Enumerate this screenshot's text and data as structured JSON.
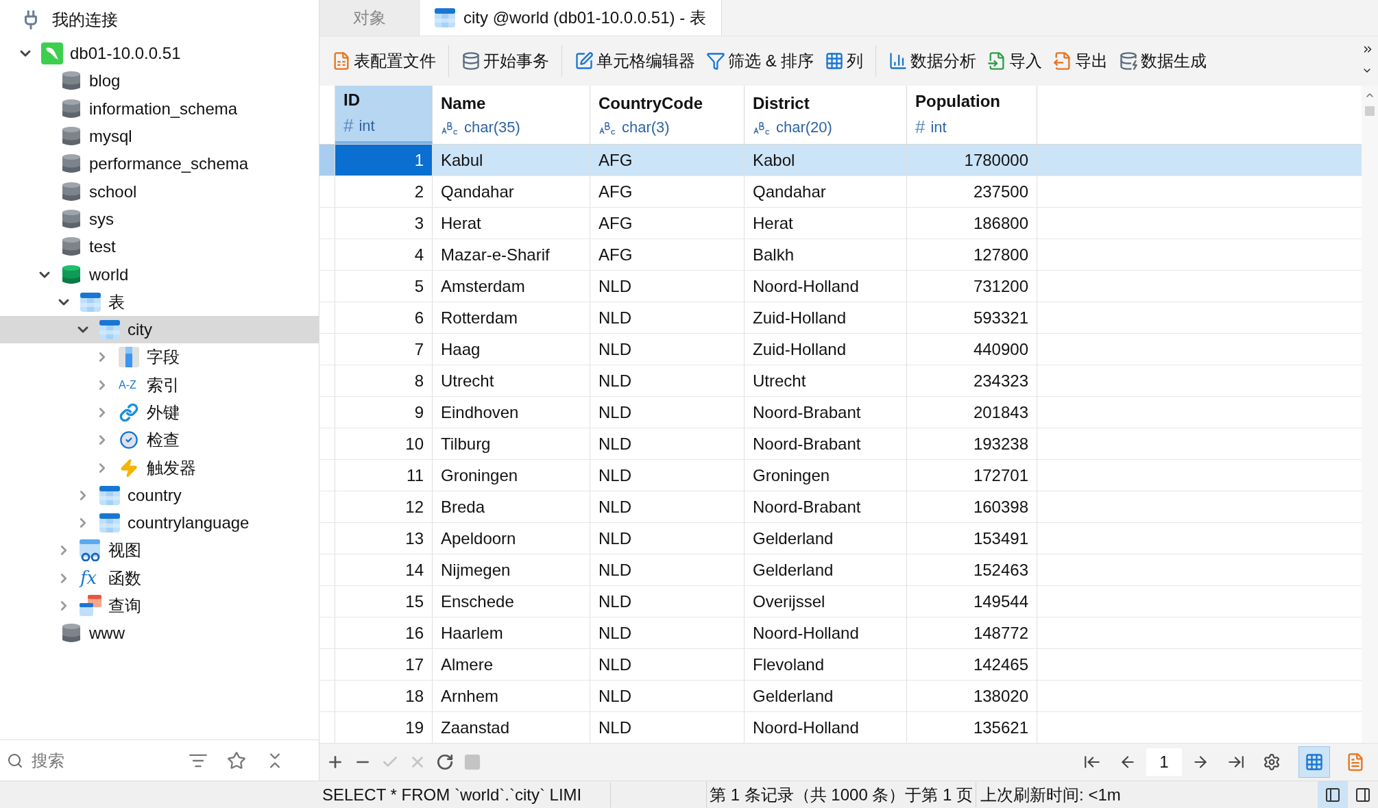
{
  "sidebar": {
    "title": "我的连接",
    "tree": [
      {
        "label": "db01-10.0.0.51",
        "kind": "connection",
        "expanded": true,
        "selected": false,
        "children": [
          {
            "label": "blog",
            "kind": "database",
            "open": false,
            "selected": false
          },
          {
            "label": "information_schema",
            "kind": "database",
            "open": false,
            "selected": false
          },
          {
            "label": "mysql",
            "kind": "database",
            "open": false,
            "selected": false
          },
          {
            "label": "performance_schema",
            "kind": "database",
            "open": false,
            "selected": false
          },
          {
            "label": "school",
            "kind": "database",
            "open": false,
            "selected": false
          },
          {
            "label": "sys",
            "kind": "database",
            "open": false,
            "selected": false
          },
          {
            "label": "test",
            "kind": "database",
            "open": false,
            "selected": false
          },
          {
            "label": "world",
            "kind": "database",
            "open": true,
            "expanded": true,
            "selected": false,
            "children": [
              {
                "label": "表",
                "kind": "tables",
                "expanded": true,
                "selected": false,
                "children": [
                  {
                    "label": "city",
                    "kind": "table",
                    "expanded": true,
                    "selected": true,
                    "children": [
                      {
                        "label": "字段",
                        "kind": "fields",
                        "expanded": false,
                        "selected": false
                      },
                      {
                        "label": "索引",
                        "kind": "index",
                        "badge": "A-Z",
                        "expanded": false,
                        "selected": false
                      },
                      {
                        "label": "外键",
                        "kind": "foreign-key",
                        "expanded": false,
                        "selected": false
                      },
                      {
                        "label": "检查",
                        "kind": "check",
                        "expanded": false,
                        "selected": false
                      },
                      {
                        "label": "触发器",
                        "kind": "trigger",
                        "expanded": false,
                        "selected": false
                      }
                    ]
                  },
                  {
                    "label": "country",
                    "kind": "table",
                    "expanded": false,
                    "selected": false
                  },
                  {
                    "label": "countrylanguage",
                    "kind": "table",
                    "expanded": false,
                    "selected": false
                  }
                ]
              },
              {
                "label": "视图",
                "kind": "view",
                "expanded": false,
                "selected": false
              },
              {
                "label": "函数",
                "kind": "function",
                "badge": "fx",
                "expanded": false,
                "selected": false
              },
              {
                "label": "查询",
                "kind": "query",
                "expanded": false,
                "selected": false
              }
            ]
          },
          {
            "label": "www",
            "kind": "database",
            "open": false,
            "selected": false
          }
        ]
      }
    ],
    "search": {
      "placeholder": "搜索"
    }
  },
  "tabs": [
    {
      "label": "对象",
      "selected": false
    },
    {
      "label": "city @world (db01-10.0.0.51) - 表",
      "selected": true
    }
  ],
  "toolbar": {
    "groups": [
      [
        {
          "label": "表配置文件",
          "kind": "profile"
        }
      ],
      [
        {
          "label": "开始事务",
          "kind": "transaction"
        }
      ],
      [
        {
          "label": "单元格编辑器",
          "kind": "editor"
        },
        {
          "label": "筛选 & 排序",
          "kind": "filter"
        },
        {
          "label": "列",
          "kind": "columns"
        }
      ],
      [
        {
          "label": "数据分析",
          "kind": "analysis"
        },
        {
          "label": "导入",
          "kind": "import"
        },
        {
          "label": "导出",
          "kind": "export"
        },
        {
          "label": "数据生成",
          "kind": "generate"
        }
      ]
    ]
  },
  "table": {
    "columns": [
      {
        "name": "ID",
        "type": "int",
        "numeric": true,
        "type_icon": "#",
        "selected": true
      },
      {
        "name": "Name",
        "type": "char(35)",
        "numeric": false,
        "selected": false
      },
      {
        "name": "CountryCode",
        "type": "char(3)",
        "numeric": false,
        "selected": false
      },
      {
        "name": "District",
        "type": "char(20)",
        "numeric": false,
        "selected": false
      },
      {
        "name": "Population",
        "type": "int",
        "numeric": true,
        "type_icon": "#",
        "selected": false
      }
    ],
    "rows": [
      {
        "cells": [
          "1",
          "Kabul",
          "AFG",
          "Kabol",
          "1780000"
        ],
        "selected": true
      },
      {
        "cells": [
          "2",
          "Qandahar",
          "AFG",
          "Qandahar",
          "237500"
        ],
        "selected": false
      },
      {
        "cells": [
          "3",
          "Herat",
          "AFG",
          "Herat",
          "186800"
        ],
        "selected": false
      },
      {
        "cells": [
          "4",
          "Mazar-e-Sharif",
          "AFG",
          "Balkh",
          "127800"
        ],
        "selected": false
      },
      {
        "cells": [
          "5",
          "Amsterdam",
          "NLD",
          "Noord-Holland",
          "731200"
        ],
        "selected": false
      },
      {
        "cells": [
          "6",
          "Rotterdam",
          "NLD",
          "Zuid-Holland",
          "593321"
        ],
        "selected": false
      },
      {
        "cells": [
          "7",
          "Haag",
          "NLD",
          "Zuid-Holland",
          "440900"
        ],
        "selected": false
      },
      {
        "cells": [
          "8",
          "Utrecht",
          "NLD",
          "Utrecht",
          "234323"
        ],
        "selected": false
      },
      {
        "cells": [
          "9",
          "Eindhoven",
          "NLD",
          "Noord-Brabant",
          "201843"
        ],
        "selected": false
      },
      {
        "cells": [
          "10",
          "Tilburg",
          "NLD",
          "Noord-Brabant",
          "193238"
        ],
        "selected": false
      },
      {
        "cells": [
          "11",
          "Groningen",
          "NLD",
          "Groningen",
          "172701"
        ],
        "selected": false
      },
      {
        "cells": [
          "12",
          "Breda",
          "NLD",
          "Noord-Brabant",
          "160398"
        ],
        "selected": false
      },
      {
        "cells": [
          "13",
          "Apeldoorn",
          "NLD",
          "Gelderland",
          "153491"
        ],
        "selected": false
      },
      {
        "cells": [
          "14",
          "Nijmegen",
          "NLD",
          "Gelderland",
          "152463"
        ],
        "selected": false
      },
      {
        "cells": [
          "15",
          "Enschede",
          "NLD",
          "Overijssel",
          "149544"
        ],
        "selected": false
      },
      {
        "cells": [
          "16",
          "Haarlem",
          "NLD",
          "Noord-Holland",
          "148772"
        ],
        "selected": false
      },
      {
        "cells": [
          "17",
          "Almere",
          "NLD",
          "Flevoland",
          "142465"
        ],
        "selected": false
      },
      {
        "cells": [
          "18",
          "Arnhem",
          "NLD",
          "Gelderland",
          "138020"
        ],
        "selected": false
      },
      {
        "cells": [
          "19",
          "Zaanstad",
          "NLD",
          "Noord-Holland",
          "135621"
        ],
        "selected": false
      }
    ]
  },
  "record_controls": [
    {
      "kind": "add",
      "disabled": false
    },
    {
      "kind": "delete",
      "disabled": false
    },
    {
      "kind": "apply",
      "disabled": true
    },
    {
      "kind": "discard",
      "disabled": true
    },
    {
      "kind": "refresh",
      "disabled": false
    },
    {
      "kind": "stop",
      "disabled": true
    }
  ],
  "pager": {
    "page": "1"
  },
  "view_modes": [
    {
      "kind": "grid",
      "selected": true
    },
    {
      "kind": "form",
      "selected": false
    }
  ],
  "status_bar": {
    "sql": "SELECT * FROM `world`.`city` LIMI",
    "record": "第 1 条记录（共 1000 条）于第 1 页",
    "refresh": "上次刷新时间: <1m",
    "panes": [
      {
        "kind": "left",
        "selected": true
      },
      {
        "kind": "right",
        "selected": false
      }
    ]
  }
}
